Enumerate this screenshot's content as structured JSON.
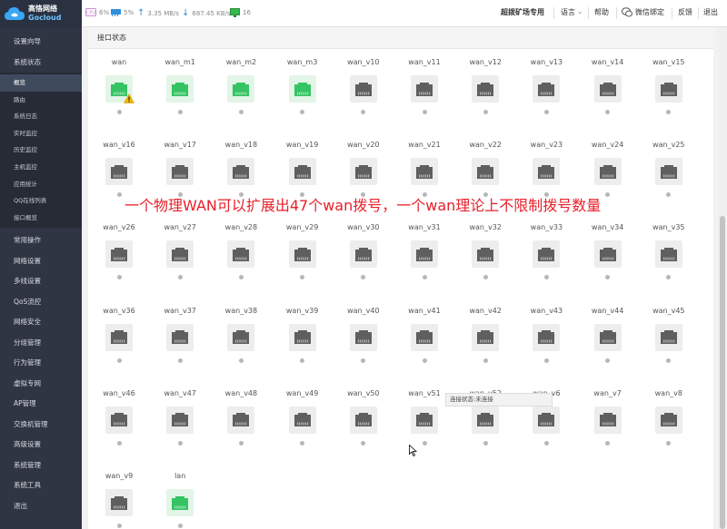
{
  "brand": {
    "cn": "高恪网络",
    "en": "Gocloud"
  },
  "status_bar": {
    "cpu": "6%",
    "memory": "5%",
    "upload": "3.35 MB/s",
    "download": "687.45 KB/s",
    "online": "16"
  },
  "top_nav": {
    "mode": "超拨矿场专用",
    "language": "语言",
    "help": "帮助",
    "wechat_bind": "微信绑定",
    "feedback": "反馈",
    "logout": "退出"
  },
  "sidebar": {
    "items_top": [
      "设置向导",
      "系统状态"
    ],
    "sub_items": [
      "概览",
      "路由",
      "系统日志",
      "实时监控",
      "历史监控",
      "主机监控",
      "应用统计",
      "QQ在线列表",
      "接口概览"
    ],
    "active_sub": "概览",
    "items_bottom": [
      "常用操作",
      "网络设置",
      "多线设置",
      "QoS流控",
      "网络安全",
      "分组管理",
      "行为管理",
      "虚拟专网",
      "AP管理",
      "交换机管理",
      "高级设置",
      "系统管理",
      "系统工具",
      "退出"
    ]
  },
  "content": {
    "section_title": "接口状态",
    "ports": [
      {
        "name": "wan",
        "state": "up",
        "warning": true
      },
      {
        "name": "wan_m1",
        "state": "up"
      },
      {
        "name": "wan_m2",
        "state": "up"
      },
      {
        "name": "wan_m3",
        "state": "up"
      },
      {
        "name": "wan_v10",
        "state": "down"
      },
      {
        "name": "wan_v11",
        "state": "down"
      },
      {
        "name": "wan_v12",
        "state": "down"
      },
      {
        "name": "wan_v13",
        "state": "down"
      },
      {
        "name": "wan_v14",
        "state": "down"
      },
      {
        "name": "wan_v15",
        "state": "down"
      },
      {
        "name": "wan_v16",
        "state": "down"
      },
      {
        "name": "wan_v17",
        "state": "down"
      },
      {
        "name": "wan_v18",
        "state": "down"
      },
      {
        "name": "wan_v19",
        "state": "down"
      },
      {
        "name": "wan_v20",
        "state": "down"
      },
      {
        "name": "wan_v21",
        "state": "down"
      },
      {
        "name": "wan_v22",
        "state": "down"
      },
      {
        "name": "wan_v23",
        "state": "down"
      },
      {
        "name": "wan_v24",
        "state": "down"
      },
      {
        "name": "wan_v25",
        "state": "down"
      },
      {
        "name": "wan_v26",
        "state": "down"
      },
      {
        "name": "wan_v27",
        "state": "down"
      },
      {
        "name": "wan_v28",
        "state": "down"
      },
      {
        "name": "wan_v29",
        "state": "down"
      },
      {
        "name": "wan_v30",
        "state": "down"
      },
      {
        "name": "wan_v31",
        "state": "down"
      },
      {
        "name": "wan_v32",
        "state": "down"
      },
      {
        "name": "wan_v33",
        "state": "down"
      },
      {
        "name": "wan_v34",
        "state": "down"
      },
      {
        "name": "wan_v35",
        "state": "down"
      },
      {
        "name": "wan_v36",
        "state": "down"
      },
      {
        "name": "wan_v37",
        "state": "down"
      },
      {
        "name": "wan_v38",
        "state": "down"
      },
      {
        "name": "wan_v39",
        "state": "down"
      },
      {
        "name": "wan_v40",
        "state": "down"
      },
      {
        "name": "wan_v41",
        "state": "down"
      },
      {
        "name": "wan_v42",
        "state": "down"
      },
      {
        "name": "wan_v43",
        "state": "down"
      },
      {
        "name": "wan_v44",
        "state": "down"
      },
      {
        "name": "wan_v45",
        "state": "down"
      },
      {
        "name": "wan_v46",
        "state": "down"
      },
      {
        "name": "wan_v47",
        "state": "down"
      },
      {
        "name": "wan_v48",
        "state": "down"
      },
      {
        "name": "wan_v49",
        "state": "down"
      },
      {
        "name": "wan_v50",
        "state": "down"
      },
      {
        "name": "wan_v51",
        "state": "down"
      },
      {
        "name": "wan_v52",
        "state": "down"
      },
      {
        "name": "wan_v6",
        "state": "down"
      },
      {
        "name": "wan_v7",
        "state": "down"
      },
      {
        "name": "wan_v8",
        "state": "down"
      },
      {
        "name": "wan_v9",
        "state": "down"
      },
      {
        "name": "lan",
        "state": "up"
      }
    ],
    "annotation": "一个物理WAN可以扩展出47个wan拨号，一个wan理论上不限制拨号数量",
    "tooltip": "连接状态:未连接"
  },
  "colors": {
    "sidebar_bg": "#2f3542",
    "port_up": "#35c463",
    "port_down": "#5f5f5f",
    "annotation": "#e8202a"
  }
}
